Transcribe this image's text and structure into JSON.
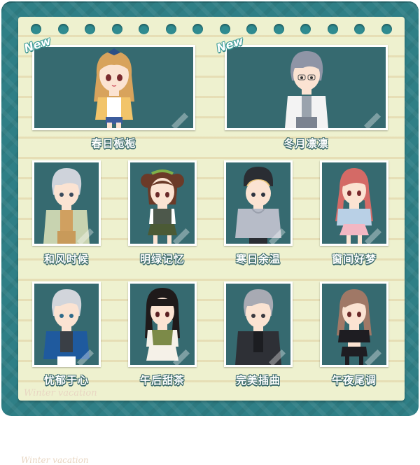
{
  "badges": {
    "new": "New"
  },
  "outfits": [
    {
      "name": "春日栀栀",
      "is_new": true
    },
    {
      "name": "冬月凛凛",
      "is_new": true
    },
    {
      "name": "和风时候"
    },
    {
      "name": "明绿记忆"
    },
    {
      "name": "寒日余温"
    },
    {
      "name": "窗间好梦"
    },
    {
      "name": "忧郁于心"
    },
    {
      "name": "午后甜茶"
    },
    {
      "name": "完美插曲"
    },
    {
      "name": "午夜尾调"
    }
  ],
  "watermark": "Winter vacation",
  "colors": {
    "frame": "#2f7f86",
    "paper": "#eef1cf",
    "card_bg": "#366a70",
    "label_outline": "#3c6b6c"
  }
}
